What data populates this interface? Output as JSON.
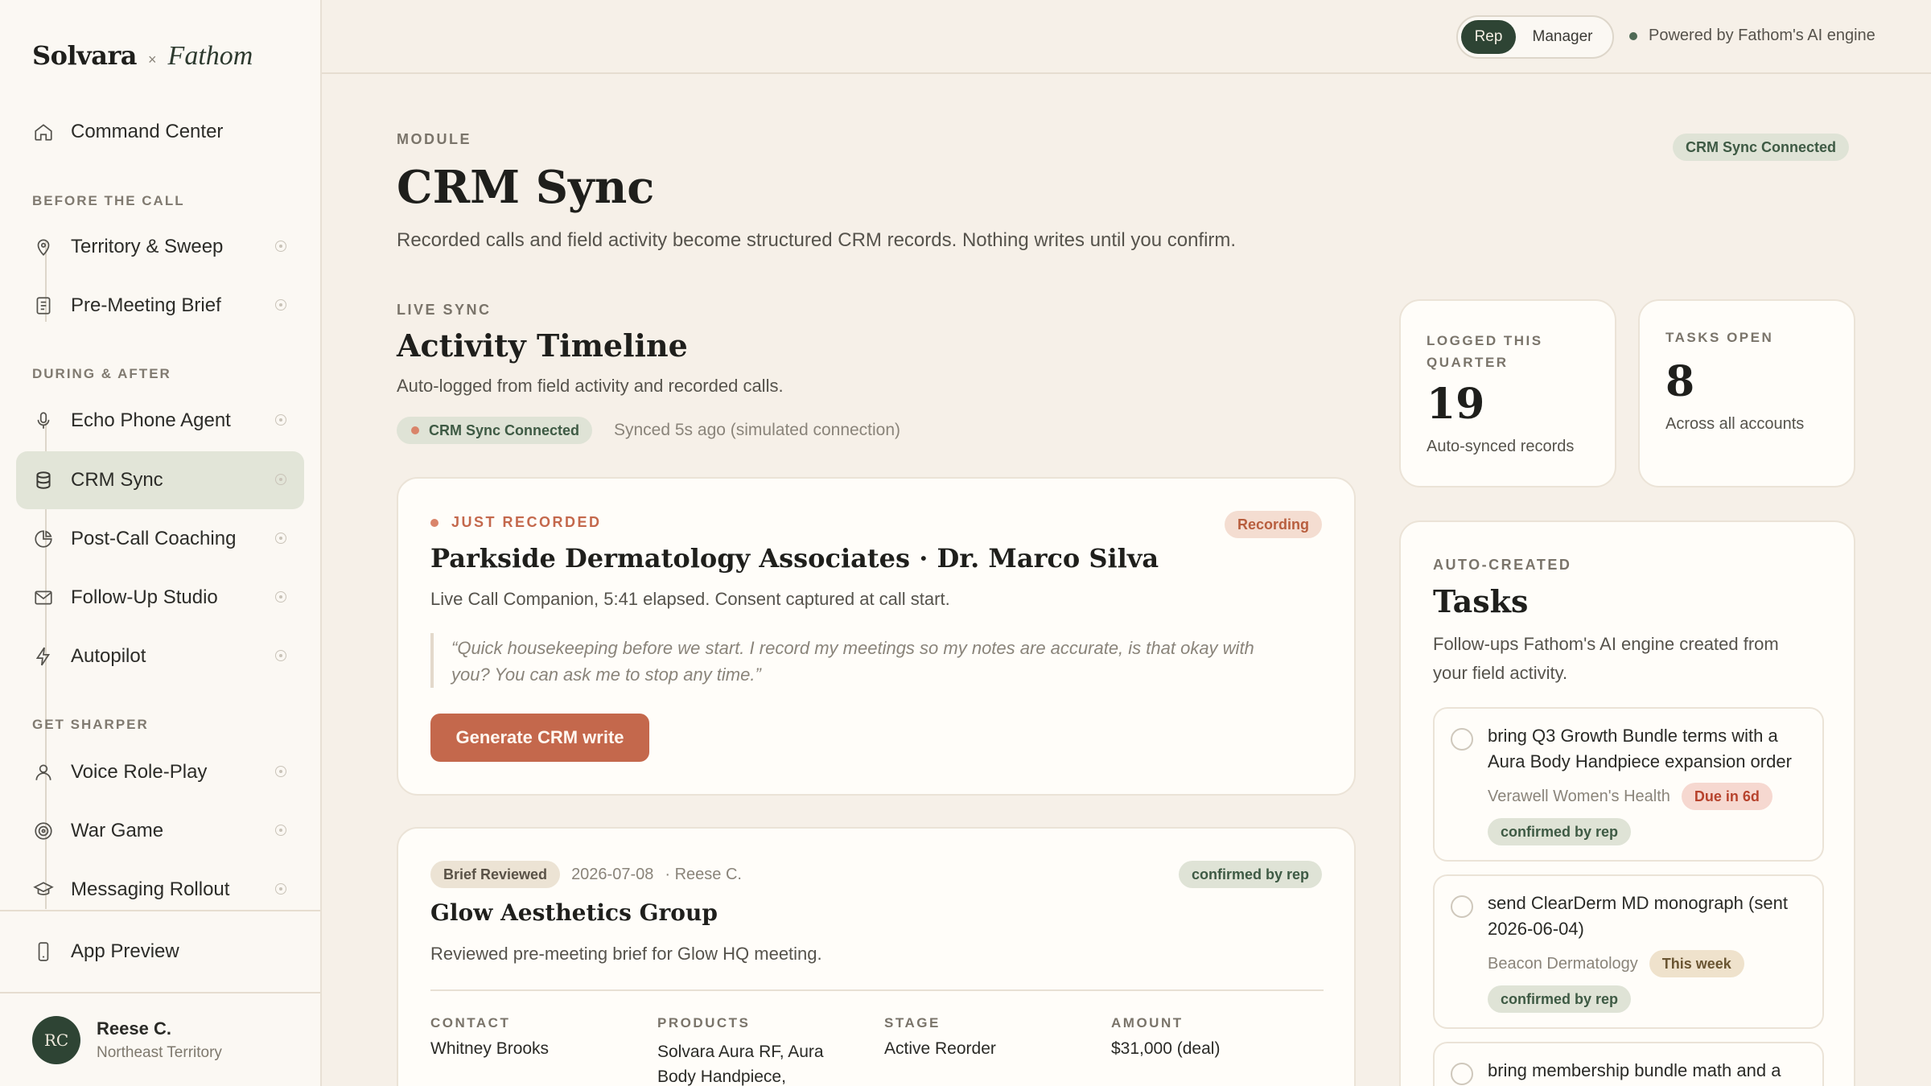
{
  "brand": {
    "name": "Solvara",
    "times": "×",
    "partner": "Fathom"
  },
  "nav": {
    "home": "Command Center",
    "section_before": "BEFORE THE CALL",
    "territory": "Territory & Sweep",
    "brief": "Pre-Meeting Brief",
    "section_during": "DURING & AFTER",
    "echo": "Echo Phone Agent",
    "crm": "CRM Sync",
    "coaching": "Post-Call Coaching",
    "followup": "Follow-Up Studio",
    "autopilot": "Autopilot",
    "section_sharper": "GET SHARPER",
    "roleplay": "Voice Role-Play",
    "wargame": "War Game",
    "rollout": "Messaging Rollout",
    "app_preview": "App Preview"
  },
  "user": {
    "initials": "RC",
    "name": "Reese C.",
    "territory": "Northeast Territory"
  },
  "topbar": {
    "mode_rep": "Rep",
    "mode_manager": "Manager",
    "powered": "Powered by Fathom's AI engine"
  },
  "header": {
    "eyebrow": "MODULE",
    "title": "CRM Sync",
    "status_pill": "CRM Sync Connected",
    "subtitle": "Recorded calls and field activity become structured CRM records. Nothing writes until you confirm."
  },
  "timeline": {
    "eyebrow": "LIVE SYNC",
    "title": "Activity Timeline",
    "subtitle": "Auto-logged from field activity and recorded calls.",
    "status_pill": "CRM Sync Connected",
    "sync_text": "Synced 5s ago (simulated connection)"
  },
  "recording": {
    "eyebrow": "JUST RECORDED",
    "badge": "Recording",
    "title": "Parkside Dermatology Associates · Dr. Marco Silva",
    "meta": "Live Call Companion, 5:41 elapsed. Consent captured at call start.",
    "quote_line1": "“Quick housekeeping before we start. I record my meetings so my notes are accurate, is that okay with",
    "quote_line2": "you? You can ask me to stop any time.”",
    "button": "Generate CRM write"
  },
  "entry": {
    "tag": "Brief Reviewed",
    "date": "2026-07-08",
    "author": "· Reese C.",
    "badge": "confirmed by rep",
    "title": "Glow Aesthetics Group",
    "desc": "Reviewed pre-meeting brief for Glow HQ meeting.",
    "fields": {
      "contact_label": "CONTACT",
      "contact_value": "Whitney Brooks",
      "products_label": "PRODUCTS",
      "products_line1": "Solvara Aura RF, Aura",
      "products_line2": "Body Handpiece,",
      "stage_label": "STAGE",
      "stage_value": "Active Reorder",
      "amount_label": "AMOUNT",
      "amount_value": "$31,000 (deal)"
    }
  },
  "stats": {
    "logged_label_1": "LOGGED THIS",
    "logged_label_2": "QUARTER",
    "logged_value": "19",
    "logged_caption": "Auto-synced records",
    "tasks_label": "TASKS OPEN",
    "tasks_value": "8",
    "tasks_caption": "Across all accounts"
  },
  "tasks": {
    "eyebrow": "AUTO-CREATED",
    "title": "Tasks",
    "desc_line1": "Follow-ups Fathom's AI engine created from",
    "desc_line2": "your field activity.",
    "items": [
      {
        "line1": "bring Q3 Growth Bundle terms with a",
        "line2": "Aura Body Handpiece expansion order",
        "account": "Verawell Women's Health",
        "due": "Due in 6d",
        "status": "confirmed by rep"
      },
      {
        "line1": "send ClearDerm MD monograph (sent",
        "line2": "2026-06-04)",
        "account": "Beacon Dermatology",
        "due": "This week",
        "status": "confirmed by rep"
      },
      {
        "line1": "bring membership bundle math and a"
      }
    ]
  },
  "colors": {
    "accent": "#c4684c",
    "brand_dark": "#2e4434",
    "active_nav": "#e2e5d8",
    "background": "#f6f0e8"
  }
}
